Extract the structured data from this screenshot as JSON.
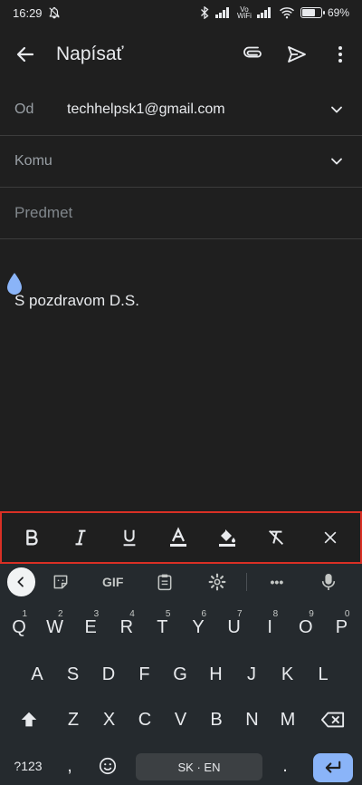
{
  "status_bar": {
    "time": "16:29",
    "battery": "69%",
    "battery_level": 0.69,
    "vo_wifi_top": "Vo",
    "vo_wifi_bottom": "WiFi"
  },
  "app_bar": {
    "title": "Napísať"
  },
  "fields": {
    "from": {
      "label": "Od",
      "value": "techhelpsk1@gmail.com"
    },
    "to": {
      "label": "Komu"
    },
    "subject": {
      "placeholder": "Predmet"
    }
  },
  "body": {
    "signature": "S pozdravom D.S."
  },
  "keyboard": {
    "gif_label": "GIF",
    "more_label": "•••",
    "row1": [
      {
        "k": "Q",
        "h": "1"
      },
      {
        "k": "W",
        "h": "2"
      },
      {
        "k": "E",
        "h": "3"
      },
      {
        "k": "R",
        "h": "4"
      },
      {
        "k": "T",
        "h": "5"
      },
      {
        "k": "Y",
        "h": "6"
      },
      {
        "k": "U",
        "h": "7"
      },
      {
        "k": "I",
        "h": "8"
      },
      {
        "k": "O",
        "h": "9"
      },
      {
        "k": "P",
        "h": "0"
      }
    ],
    "row2": [
      "A",
      "S",
      "D",
      "F",
      "G",
      "H",
      "J",
      "K",
      "L"
    ],
    "row3": [
      "Z",
      "X",
      "C",
      "V",
      "B",
      "N",
      "M"
    ],
    "sym_label": "?123",
    "space_label": "SK · EN",
    "comma": ",",
    "period": "."
  },
  "colors": {
    "background": "#1f1f1f",
    "highlight_border": "#d93025",
    "keyboard_bg": "#252a2e",
    "enter_key": "#8ab4f8",
    "cursor_drop": "#8ab4f8"
  }
}
